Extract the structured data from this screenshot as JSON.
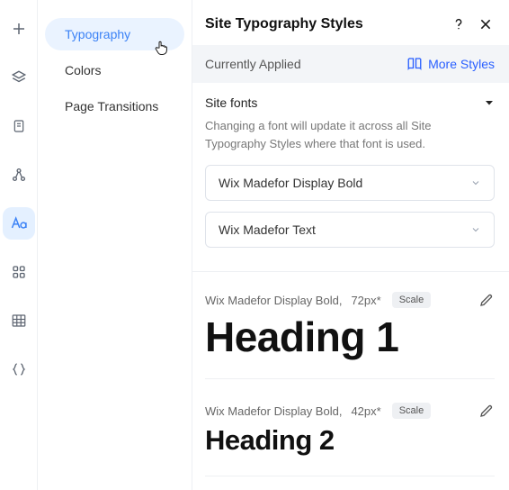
{
  "sidebar": {
    "items": [
      {
        "label": "Typography"
      },
      {
        "label": "Colors"
      },
      {
        "label": "Page Transitions"
      }
    ]
  },
  "panel": {
    "title": "Site Typography Styles",
    "applied_label": "Currently Applied",
    "more_styles_label": "More Styles",
    "site_fonts": {
      "title": "Site fonts",
      "description": "Changing a font will update it across all Site Typography Styles where that font is used.",
      "selects": [
        {
          "value": "Wix Madefor Display Bold"
        },
        {
          "value": "Wix Madefor Text"
        }
      ]
    },
    "styles": [
      {
        "font": "Wix Madefor Display Bold",
        "size": "72px*",
        "badge": "Scale",
        "sample": "Heading 1"
      },
      {
        "font": "Wix Madefor Display Bold",
        "size": "42px*",
        "badge": "Scale",
        "sample": "Heading 2"
      }
    ]
  }
}
